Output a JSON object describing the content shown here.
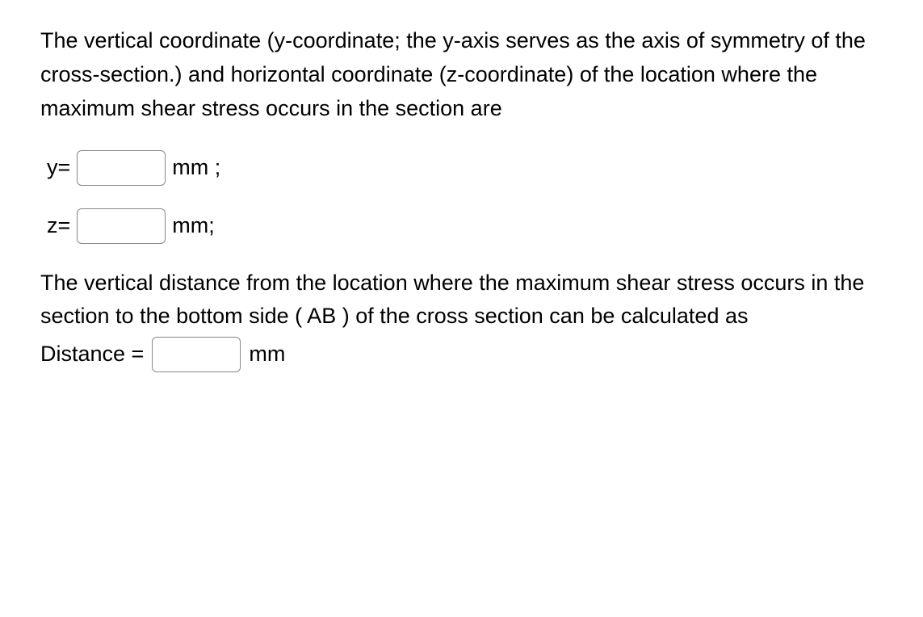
{
  "question1": {
    "text": "The vertical coordinate (y-coordinate; the y-axis serves as the axis of symmetry of the cross-section.) and horizontal coordinate (z-coordinate) of the location where the maximum shear stress occurs in the section are"
  },
  "inputs": {
    "y": {
      "label": "y=",
      "unit": "mm ;"
    },
    "z": {
      "label": "z=",
      "unit": "mm;"
    },
    "distance": {
      "label": "Distance =",
      "unit": "mm"
    }
  },
  "question2": {
    "text": "The vertical distance from the location where the maximum shear stress occurs in the section to the bottom side ( AB ) of the cross section can be calculated as"
  }
}
